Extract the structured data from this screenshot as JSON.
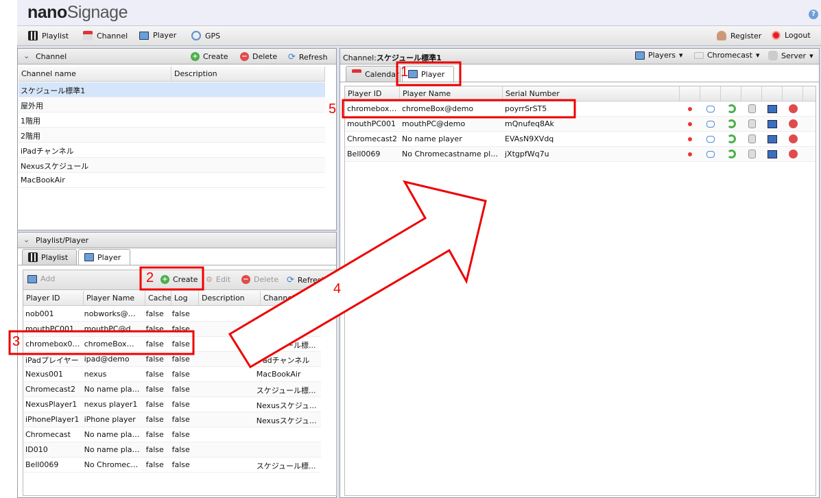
{
  "app": {
    "logo_bold": "nano",
    "logo_light": "Signage"
  },
  "toolbar": {
    "items": [
      {
        "label": "Playlist",
        "icon": "film-icon"
      },
      {
        "label": "Channel",
        "icon": "calendar-icon"
      },
      {
        "label": "Player",
        "icon": "tv-icon"
      },
      {
        "label": "GPS",
        "icon": "antenna-icon"
      }
    ],
    "register": "Register",
    "logout": "Logout"
  },
  "channel_panel": {
    "title": "Channel",
    "create": "Create",
    "delete": "Delete",
    "refresh": "Refresh",
    "columns": [
      "Channel name",
      "Description"
    ],
    "rows": [
      "スケジュール標準1",
      "屋外用",
      "1階用",
      "2階用",
      "iPadチャンネル",
      "Nexusスケジュール",
      "MacBookAir"
    ]
  },
  "playlist_panel": {
    "title": "Playlist/Player",
    "tabs": [
      "Playlist",
      "Player"
    ],
    "add": "Add",
    "create": "Create",
    "edit": "Edit",
    "delete": "Delete",
    "refresh": "Refresh",
    "columns": [
      "Player ID",
      "Player Name",
      "Cache",
      "Log",
      "Description",
      "Channel"
    ],
    "rows": [
      [
        "nob001",
        "nobworks@de...",
        "false",
        "false",
        "",
        ""
      ],
      [
        "mouthPC001",
        "mouthPC@demo",
        "false",
        "false",
        "",
        ""
      ],
      [
        "chromebox001",
        "chromeBox@...",
        "false",
        "false",
        "",
        "スケジュール標..."
      ],
      [
        "iPadプレイヤー",
        "ipad@demo",
        "false",
        "false",
        "",
        "iPadチャンネル"
      ],
      [
        "Nexus001",
        "nexus",
        "false",
        "false",
        "",
        "MacBookAir"
      ],
      [
        "Chromecast2",
        "No name player",
        "false",
        "false",
        "",
        "スケジュール標..."
      ],
      [
        "NexusPlayer1",
        "nexus player1",
        "false",
        "false",
        "",
        "Nexusスケジュ..."
      ],
      [
        "iPhonePlayer1",
        "iPhone player",
        "false",
        "false",
        "",
        "Nexusスケジュ..."
      ],
      [
        "Chromecast",
        "No name player",
        "false",
        "false",
        "",
        ""
      ],
      [
        "ID010",
        "No name player",
        "false",
        "false",
        "",
        ""
      ],
      [
        "Bell0069",
        "No Chromeca...",
        "false",
        "false",
        "",
        "スケジュール標..."
      ]
    ]
  },
  "right_panel": {
    "title_prefix": "Channel:",
    "title_channel": "スケジュール標準1",
    "menus": [
      "Players",
      "Chromecast",
      "Server"
    ],
    "tabs": [
      "Calendar",
      "Player"
    ],
    "columns": [
      "Player ID",
      "Player Name",
      "Serial Number"
    ],
    "rows": [
      [
        "chromebox001",
        "chromeBox@demo",
        "poyrrSrST5"
      ],
      [
        "mouthPC001",
        "mouthPC@demo",
        "mQnufeq8Ak"
      ],
      [
        "Chromecast2",
        "No name player",
        "EVAsN9XVdq"
      ],
      [
        "Bell0069",
        "No Chromecastname player",
        "jXtgpfWq7u"
      ]
    ],
    "row_actions": [
      "status-dot-icon",
      "message-icon",
      "sync-icon",
      "database-icon",
      "monitor-icon",
      "remove-icon"
    ]
  },
  "annotations": [
    "1",
    "2",
    "3",
    "4",
    "5"
  ]
}
